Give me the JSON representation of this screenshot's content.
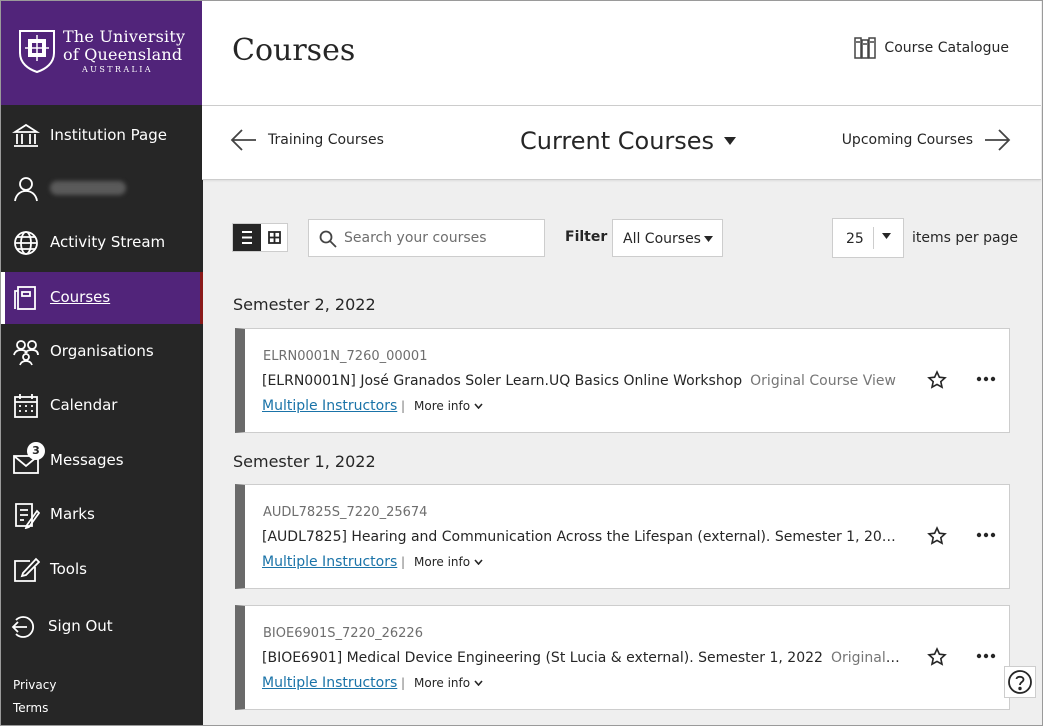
{
  "brand": {
    "line1": "The University",
    "line2": "of Queensland",
    "line3": "AUSTRALIA"
  },
  "sidebar": {
    "items": [
      {
        "label": "Institution Page",
        "icon": "institution-icon"
      },
      {
        "label": "",
        "icon": "user-icon",
        "blurred": true
      },
      {
        "label": "Activity Stream",
        "icon": "globe-icon"
      },
      {
        "label": "Courses",
        "icon": "courses-icon",
        "active": true
      },
      {
        "label": "Organisations",
        "icon": "organisations-icon"
      },
      {
        "label": "Calendar",
        "icon": "calendar-icon"
      },
      {
        "label": "Messages",
        "icon": "messages-icon",
        "badge": "3"
      },
      {
        "label": "Marks",
        "icon": "marks-icon"
      },
      {
        "label": "Tools",
        "icon": "tools-icon"
      },
      {
        "label": "Sign Out",
        "icon": "sign-out-icon"
      }
    ],
    "footer": {
      "privacy": "Privacy",
      "terms": "Terms"
    }
  },
  "header": {
    "title": "Courses",
    "catalogue": "Course Catalogue"
  },
  "terms": {
    "prev": "Training Courses",
    "current": "Current Courses",
    "next": "Upcoming Courses"
  },
  "toolbar": {
    "search_placeholder": "Search your courses",
    "filter_label": "Filter",
    "filter_value": "All Courses",
    "per_page_value": "25",
    "per_page_label": "items per page"
  },
  "semesters": [
    {
      "title": "Semester 2, 2022",
      "courses": [
        {
          "id": "ELRN0001N_7260_00001",
          "name": "[ELRN0001N] José Granados Soler Learn.UQ Basics Online Workshop",
          "view": "Original Course View",
          "instructors": "Multiple Instructors",
          "more": "More info"
        }
      ]
    },
    {
      "title": "Semester 1, 2022",
      "courses": [
        {
          "id": "AUDL7825S_7220_25674",
          "name": "[AUDL7825] Hearing and Communication Across the Lifespan (external). Semester 1, 202...",
          "view": "",
          "instructors": "Multiple Instructors",
          "more": "More info"
        },
        {
          "id": "BIOE6901S_7220_26226",
          "name": "[BIOE6901] Medical Device Engineering (St Lucia & external). Semester 1, 2022",
          "view": "Original C...",
          "instructors": "Multiple Instructors",
          "more": "More info"
        }
      ]
    }
  ],
  "colors": {
    "brand_purple": "#51247a",
    "sidebar_bg": "#262626",
    "link_blue": "#1a73a8"
  }
}
